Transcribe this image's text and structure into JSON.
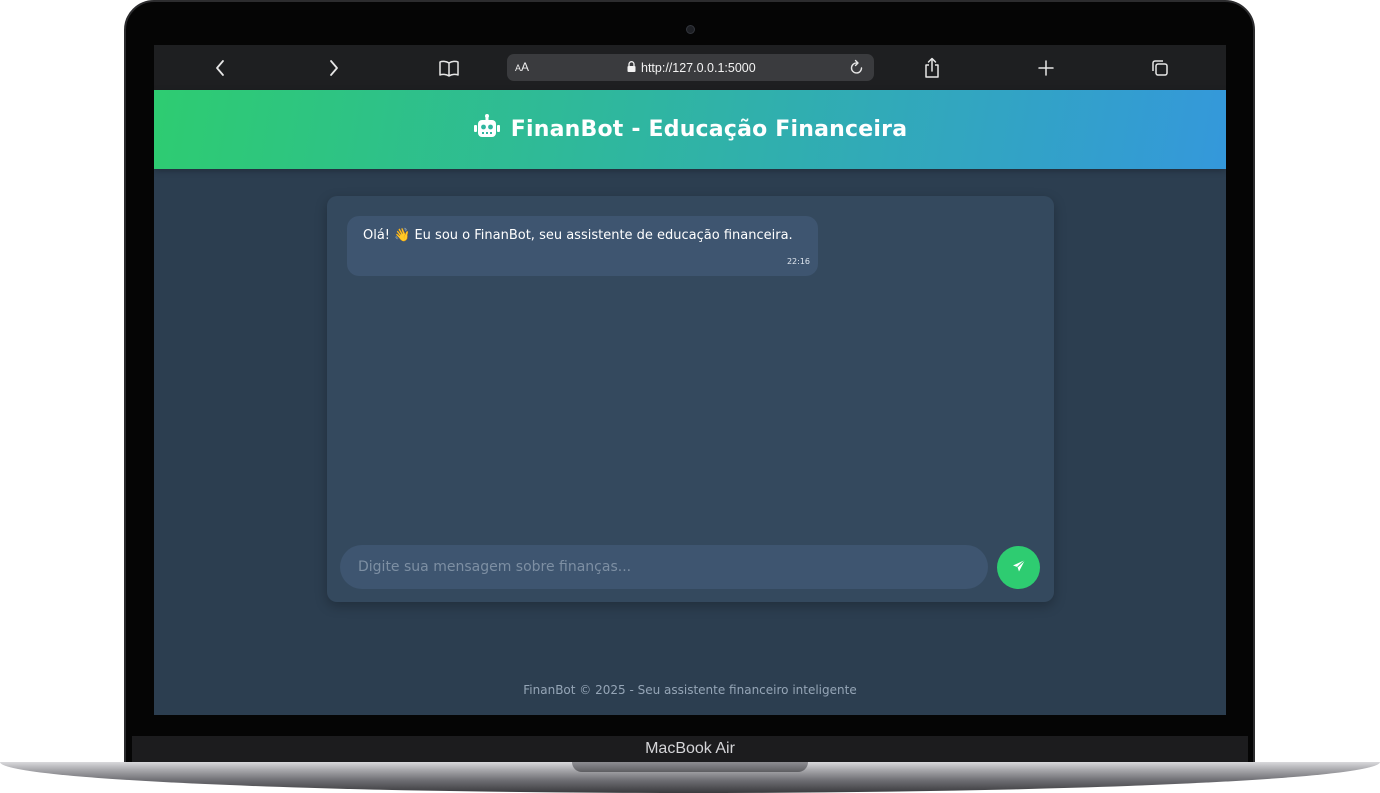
{
  "browser": {
    "url": "http://127.0.0.1:5000",
    "text_size_label": "AA"
  },
  "header": {
    "title": "FinanBot - Educação Financeira",
    "icon": "robot-icon"
  },
  "chat": {
    "messages": [
      {
        "sender": "bot",
        "text": "Olá! 👋 Eu sou o FinanBot, seu assistente de educação financeira.",
        "time": "22:16"
      }
    ],
    "input_placeholder": "Digite sua mensagem sobre finanças...",
    "send_icon": "paper-plane-icon"
  },
  "footer": {
    "text": "FinanBot © 2025 - Seu assistente financeiro inteligente"
  },
  "device": {
    "label": "MacBook Air"
  },
  "colors": {
    "page_bg": "#2c3e50",
    "panel_bg": "#34495e",
    "bubble_bg": "#3e5570",
    "accent_green": "#2ecc71",
    "accent_blue": "#3498db"
  }
}
